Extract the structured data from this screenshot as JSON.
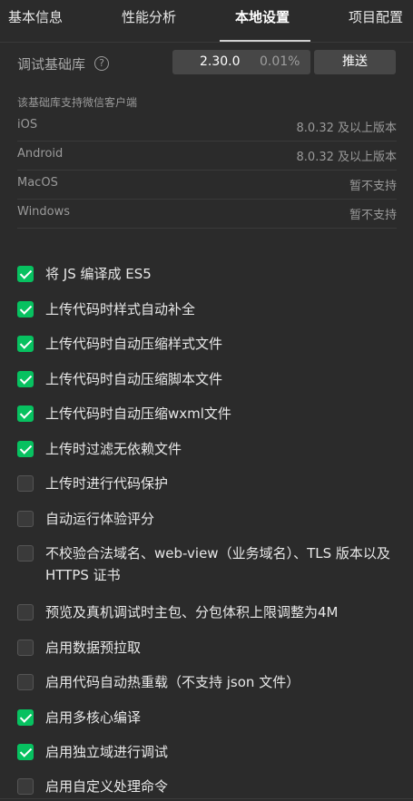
{
  "tabs": [
    {
      "label": "基本信息"
    },
    {
      "label": "性能分析"
    },
    {
      "label": "本地设置",
      "active": true
    },
    {
      "label": "项目配置"
    }
  ],
  "lib": {
    "label": "调试基础库",
    "help_icon": "question-circle-icon",
    "version": "2.30.0",
    "percent": "0.01%",
    "push_label": "推送"
  },
  "support": {
    "note": "该基础库支持微信客户端",
    "platforms": [
      {
        "name": "iOS",
        "value": "8.0.32 及以上版本"
      },
      {
        "name": "Android",
        "value": "8.0.32 及以上版本"
      },
      {
        "name": "MacOS",
        "value": "暂不支持"
      },
      {
        "name": "Windows",
        "value": "暂不支持"
      }
    ]
  },
  "options": [
    {
      "label": "将 JS 编译成 ES5",
      "checked": true
    },
    {
      "label": "上传代码时样式自动补全",
      "checked": true
    },
    {
      "label": "上传代码时自动压缩样式文件",
      "checked": true
    },
    {
      "label": "上传代码时自动压缩脚本文件",
      "checked": true
    },
    {
      "label": "上传代码时自动压缩wxml文件",
      "checked": true
    },
    {
      "label": "上传时过滤无依赖文件",
      "checked": true
    },
    {
      "label": "上传时进行代码保护",
      "checked": false
    },
    {
      "label": "自动运行体验评分",
      "checked": false
    },
    {
      "label": "不校验合法域名、web-view（业务域名）、TLS 版本以及 HTTPS 证书",
      "checked": false
    },
    {
      "label": "预览及真机调试时主包、分包体积上限调整为4M",
      "checked": false
    },
    {
      "label": "启用数据预拉取",
      "checked": false
    },
    {
      "label": "启用代码自动热重载（不支持 json 文件）",
      "checked": false
    },
    {
      "label": "启用多核心编译",
      "checked": true
    },
    {
      "label": "启用独立域进行调试",
      "checked": true
    },
    {
      "label": "启用自定义处理命令",
      "checked": false
    }
  ],
  "colors": {
    "background": "#2b2b2b",
    "checkbox_checked": "#07c160",
    "control_bg": "#474747"
  }
}
